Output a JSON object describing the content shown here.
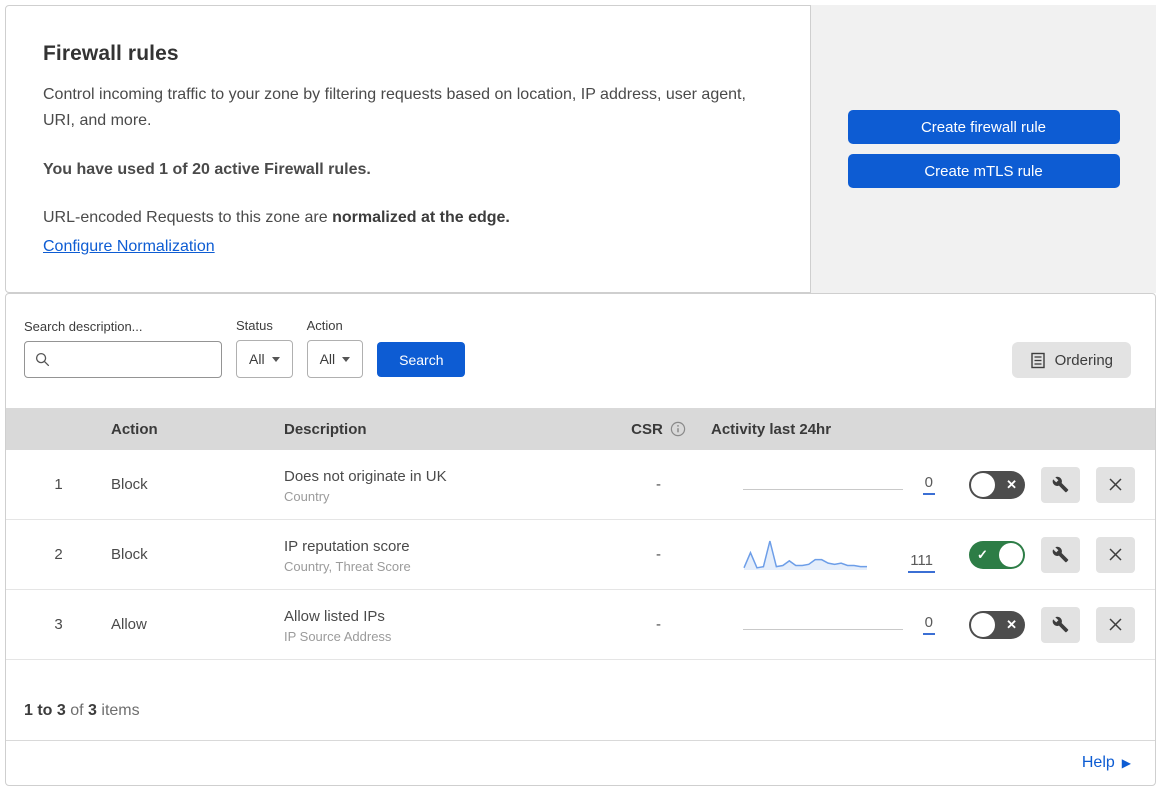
{
  "header": {
    "title": "Firewall rules",
    "description": "Control incoming traffic to your zone by filtering requests based on location, IP address, user agent, URI, and more.",
    "usage": "You have used 1 of 20 active Firewall rules.",
    "normalization_prefix": "URL-encoded Requests to this zone are ",
    "normalization_bold": "normalized at the edge.",
    "normalization_link": "Configure Normalization",
    "create_firewall_button": "Create firewall rule",
    "create_mtls_button": "Create mTLS rule"
  },
  "filters": {
    "search_label": "Search description...",
    "status_label": "Status",
    "status_value": "All",
    "action_label": "Action",
    "action_value": "All",
    "search_button": "Search",
    "ordering_button": "Ordering"
  },
  "table": {
    "headers": {
      "action": "Action",
      "description": "Description",
      "csr": "CSR",
      "activity": "Activity last 24hr"
    },
    "rows": [
      {
        "index": "1",
        "action": "Block",
        "description": "Does not originate in UK",
        "criteria": "Country",
        "csr": "-",
        "activity_count": "0",
        "enabled": false
      },
      {
        "index": "2",
        "action": "Block",
        "description": "IP reputation score",
        "criteria": "Country, Threat Score",
        "csr": "-",
        "activity_count": "111",
        "enabled": true,
        "sparkline": [
          1,
          14,
          1,
          2,
          24,
          2,
          3,
          7,
          3,
          3,
          4,
          8,
          8,
          5,
          4,
          5,
          3,
          3,
          2,
          2
        ]
      },
      {
        "index": "3",
        "action": "Allow",
        "description": "Allow listed IPs",
        "criteria": "IP Source Address",
        "csr": "-",
        "activity_count": "0",
        "enabled": false
      }
    ]
  },
  "footer": {
    "range": "1 to 3",
    "of": "of",
    "total": "3",
    "items": "items",
    "help_label": "Help"
  },
  "colors": {
    "accent": "#0d5cd3",
    "toggle_on": "#2d7d46",
    "toggle_off": "#4d4d4d",
    "spark": "#6d9ee8",
    "thead_bg": "#d9d9d9",
    "panel_gray": "#f1f1f1"
  }
}
